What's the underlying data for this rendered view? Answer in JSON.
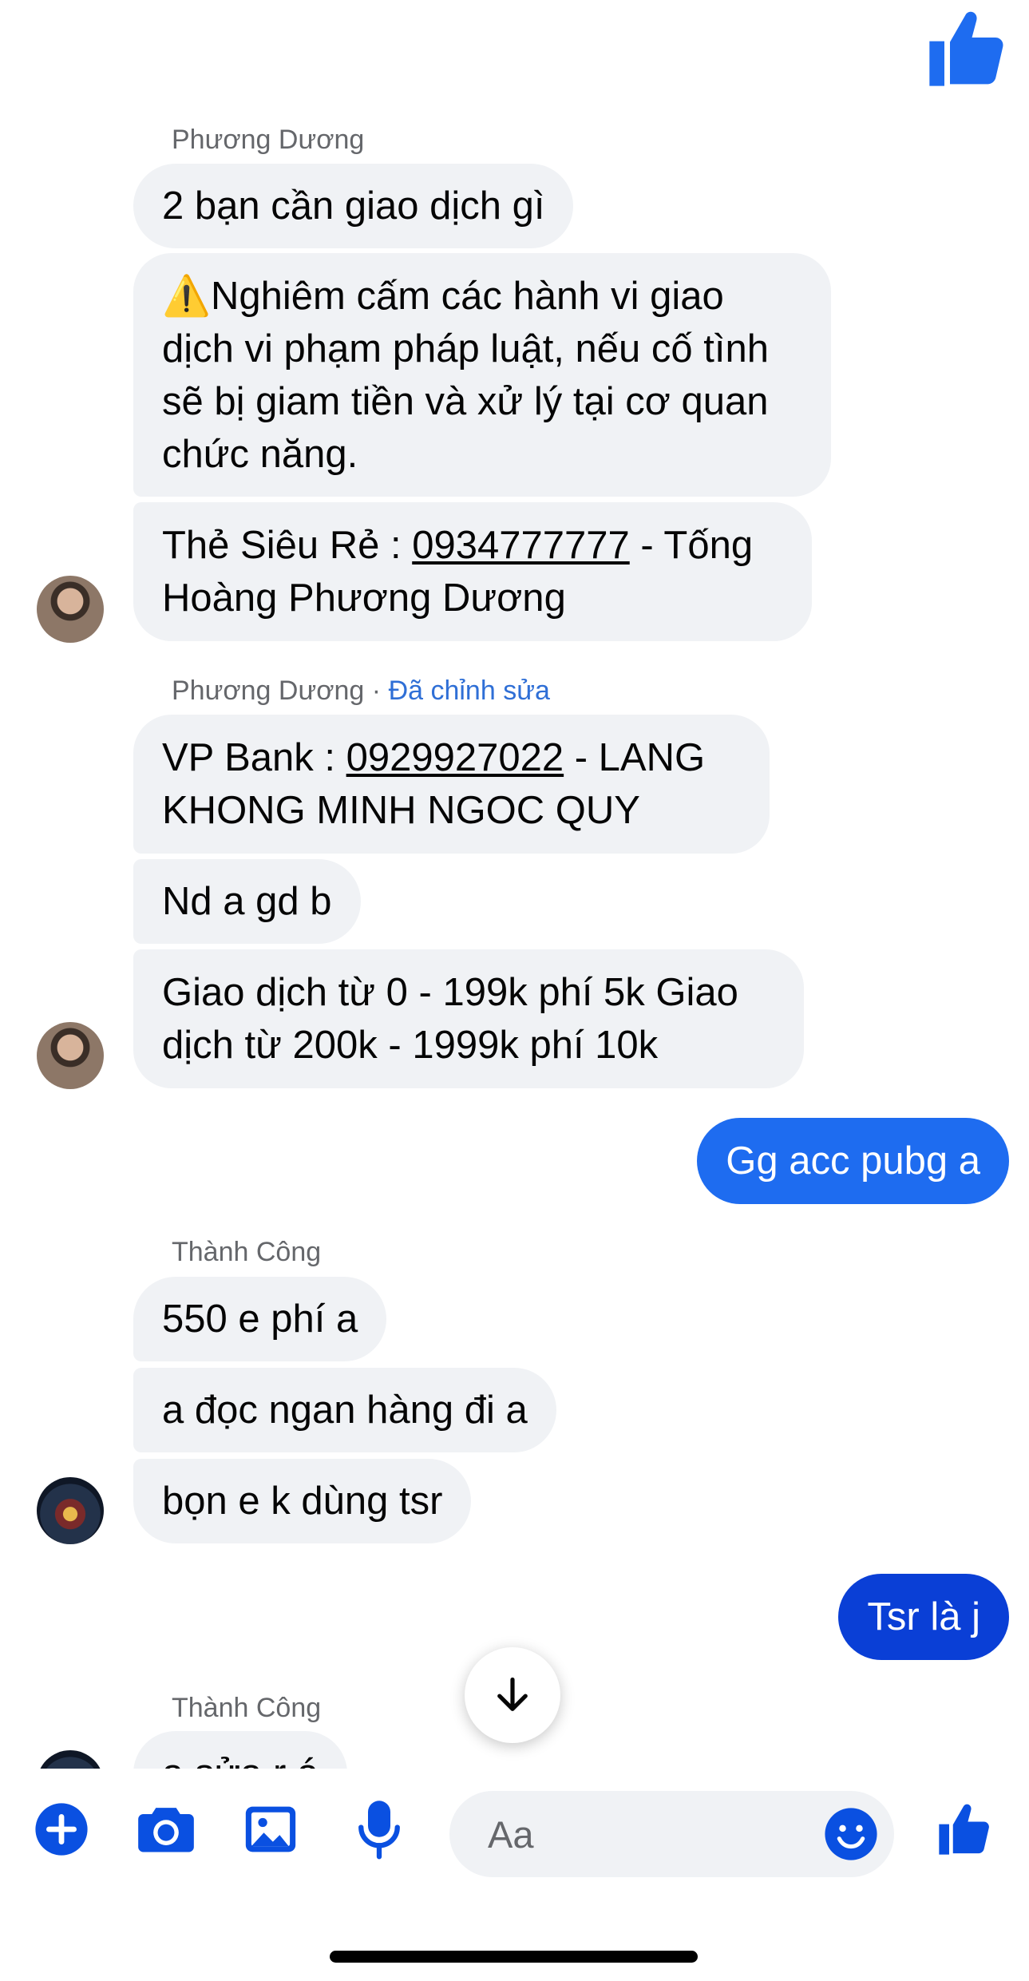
{
  "colors": {
    "accent": "#0a50e1",
    "accent_light": "#1e6cf0",
    "incoming_bubble": "#f0f2f5",
    "meta_text": "#65676b",
    "edited_link": "#2f6fd6"
  },
  "thread": {
    "groups": [
      {
        "sender": "Phương Dương",
        "messages": [
          "2 bạn cần giao dịch gì",
          "⚠️Nghiêm cấm các hành vi giao dịch vi phạm pháp luật, nếu cố tình sẽ bị giam tiền và xử lý tại cơ quan chức năng.",
          {
            "prefix": "Thẻ Siêu Rẻ : ",
            "link": "0934777777",
            "suffix": " - Tống Hoàng Phương Dương"
          }
        ]
      },
      {
        "sender": "Phương Dương",
        "edited_label": "Đã chỉnh sửa",
        "messages": [
          {
            "prefix": "VP Bank : ",
            "link": "0929927022",
            "suffix": " - LANG KHONG MINH NGOC QUY"
          },
          "Nd a gd b",
          "Giao dịch từ 0 - 199k phí 5k  Giao dịch từ 200k - 1999k phí 10k"
        ]
      },
      {
        "sender": "Thành Công",
        "messages": [
          "550 e phí a",
          "a đọc ngan hàng đi a",
          "bọn e k dùng tsr"
        ]
      },
      {
        "sender": "Thành Công",
        "messages": [
          "a sửa r á"
        ]
      }
    ],
    "outgoing": [
      "Gg acc pubg a",
      "Tsr là j"
    ],
    "separator": " · "
  },
  "icons": {
    "top_like": "thumbs-up-icon",
    "scroll_down": "arrow-down-icon",
    "add": "plus-circle-icon",
    "camera": "camera-icon",
    "gallery": "image-icon",
    "voice": "microphone-icon",
    "emoji": "smiley-icon",
    "send_like": "thumbs-up-icon"
  },
  "composer": {
    "placeholder": "Aa"
  }
}
